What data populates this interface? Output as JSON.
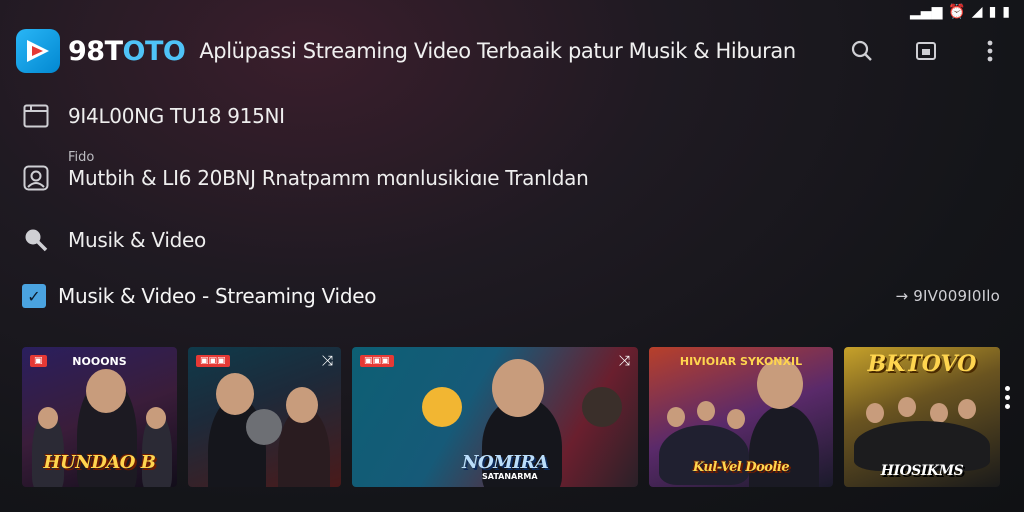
{
  "status_bar": {
    "signal_icon": "signal-icon",
    "alarm_icon": "alarm-icon",
    "signal2_icon": "signal-weak-icon",
    "battery_icon": "battery-icon",
    "battery2_icon": "battery-icon"
  },
  "app_bar": {
    "brand_prefix": "98T",
    "brand_suffix": "OTO",
    "subtitle": "Aplüpassi Streaming Video Terbaaik patur Musik & Hiburan",
    "actions": [
      "search-icon",
      "cast-icon",
      "more-vert-icon"
    ]
  },
  "rows": [
    {
      "icon": "tablet-icon",
      "text": "9I4ᒪ00NG TU18 915NI"
    },
    {
      "icon": "account-box-icon",
      "caption": "Fido",
      "text": "Mutbih & LI6 20BNJ  Rnatpamm mɑnlusikiɑıe Tranldan"
    },
    {
      "icon": "search-icon",
      "text": "Musik & Video"
    }
  ],
  "section": {
    "check_icon": "check-icon",
    "title": "Musik & Video - Streaming Video",
    "more": "→ 9IV009I0Ilo"
  },
  "cards": [
    {
      "tag": "▣",
      "top": "NOOONS",
      "title": "HUNDAO B",
      "sub": ""
    },
    {
      "tag": "▣▣▣",
      "top": "",
      "title": "",
      "sub": "",
      "shuffle": "⤨"
    },
    {
      "tag": "▣▣▣",
      "top": "",
      "title": "NOMIRA",
      "sub": "SATANARMA",
      "shuffle": "⤨"
    },
    {
      "tag": "",
      "top": "HIVIOIAR SYKONXIL",
      "title": "Kul-Vel Doolie",
      "sub": ""
    },
    {
      "tag": "",
      "top": "",
      "title": "BKTOVO",
      "sub": "HIOSIKMS"
    }
  ],
  "colors": {
    "accent": "#4fc3f7",
    "check": "#4aa3e0",
    "tag": "#e53935"
  }
}
